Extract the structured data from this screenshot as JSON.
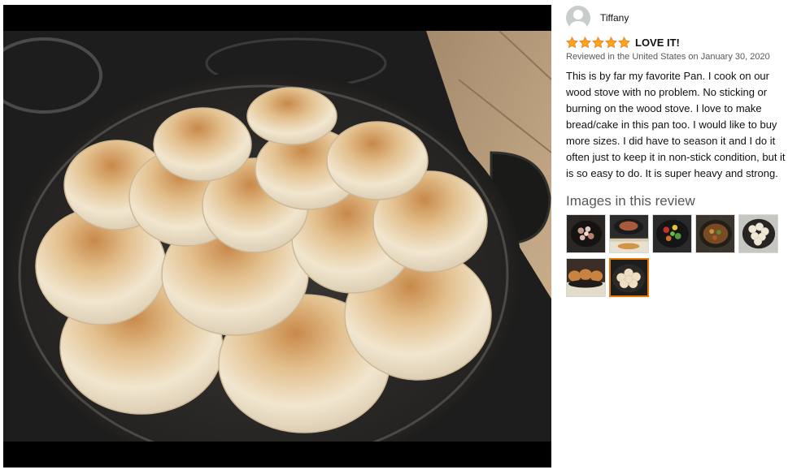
{
  "review": {
    "author": "Tiffany",
    "rating": 5,
    "rating_max": 5,
    "title": "LOVE IT!",
    "meta": "Reviewed in the United States on January 30, 2020",
    "body": "This is by far my favorite Pan. I cook on our wood stove with no problem. No sticking or burning on the wood stove. I love to make bread/cake in this pan too. I would like to buy more sizes. I did have to season it and I do it often just to keep it in non-stick condition, but it is so easy to do. It is super heavy and strong."
  },
  "images_section": {
    "heading": "Images in this review",
    "thumbnails": [
      {
        "subject": "skillet with diced meat"
      },
      {
        "subject": "skillet on stovetop"
      },
      {
        "subject": "skillet with vegetables"
      },
      {
        "subject": "skillet with stew"
      },
      {
        "subject": "skillet with dough rolls"
      },
      {
        "subject": "baked rolls side view"
      },
      {
        "subject": "baked rolls in skillet",
        "selected": true
      }
    ]
  },
  "main_image": {
    "subject": "baked dinner rolls in cast iron skillet"
  },
  "colors": {
    "star": "#ffa41c",
    "selected_border": "#e77600",
    "meta_text": "#565959",
    "viewer_bg": "#000000"
  },
  "icons": {
    "avatar": "default-user-icon",
    "star": "star-icon"
  }
}
